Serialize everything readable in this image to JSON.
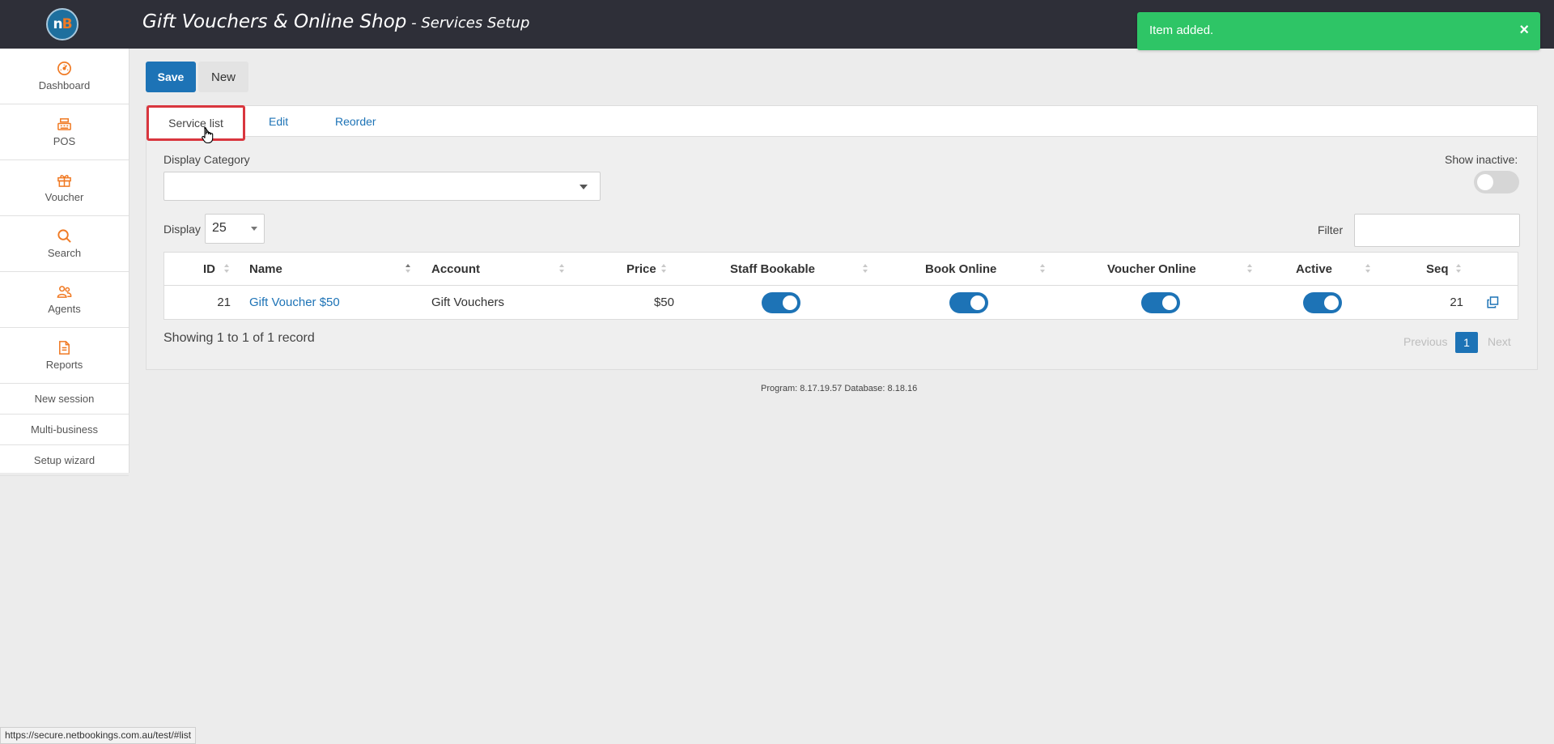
{
  "header": {
    "logo_text_a": "n",
    "logo_text_b": "B",
    "title": "Gift Vouchers & Online Shop",
    "title_separator": " - ",
    "subtitle": "Services Setup"
  },
  "toast": {
    "message": "Item added.",
    "close_label": "×",
    "color": "#2ec566"
  },
  "sidebar": {
    "items": [
      {
        "label": "Dashboard",
        "icon": "dashboard-icon"
      },
      {
        "label": "POS",
        "icon": "cash-register-icon"
      },
      {
        "label": "Voucher",
        "icon": "gift-icon"
      },
      {
        "label": "Search",
        "icon": "search-icon"
      },
      {
        "label": "Agents",
        "icon": "agents-icon"
      },
      {
        "label": "Reports",
        "icon": "document-icon"
      }
    ],
    "links": [
      "New session",
      "Multi-business",
      "Setup wizard"
    ],
    "icon_color": "#f07a24"
  },
  "toolbar": {
    "save_label": "Save",
    "new_label": "New"
  },
  "tabs": [
    {
      "label": "Service list",
      "active": true
    },
    {
      "label": "Edit",
      "active": false
    },
    {
      "label": "Reorder",
      "active": false
    }
  ],
  "filters": {
    "display_category_label": "Display Category",
    "display_category_value": "",
    "show_inactive_label": "Show inactive:",
    "show_inactive": false,
    "display_label": "Display",
    "page_size": "25",
    "filter_label": "Filter",
    "filter_value": ""
  },
  "table": {
    "columns": [
      "ID",
      "Name",
      "Account",
      "Price",
      "Staff Bookable",
      "Book Online",
      "Voucher Online",
      "Active",
      "Seq"
    ],
    "rows": [
      {
        "id": "21",
        "name": "Gift Voucher $50",
        "account": "Gift Vouchers",
        "price": "$50",
        "staff_bookable": true,
        "book_online": true,
        "voucher_online": true,
        "active": true,
        "seq": "21"
      }
    ]
  },
  "pagination": {
    "summary": "Showing 1 to 1 of 1 record",
    "previous": "Previous",
    "current": "1",
    "next": "Next"
  },
  "footer": {
    "version": "Program: 8.17.19.57 Database: 8.18.16"
  },
  "status_bar": {
    "url": "https://secure.netbookings.com.au/test/#list"
  },
  "colors": {
    "primary": "#1d73b6",
    "topbar": "#2e2f38",
    "highlight": "#d9363e"
  }
}
